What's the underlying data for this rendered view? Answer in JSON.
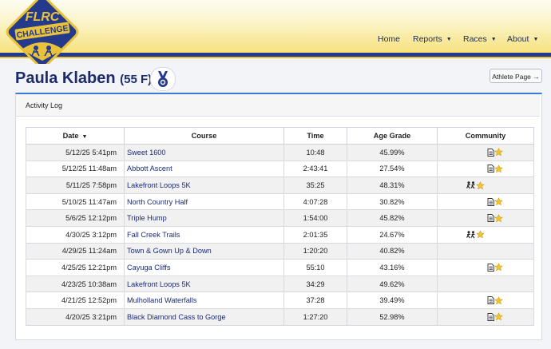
{
  "header": {
    "logo_text_top": "FLRC",
    "logo_text_main": "CHALLENGE",
    "nav": [
      {
        "label": "Home",
        "caret": false
      },
      {
        "label": "Reports",
        "caret": true
      },
      {
        "label": "Races",
        "caret": true
      },
      {
        "label": "About",
        "caret": true
      }
    ],
    "colors": {
      "navy": "#263a8c",
      "gold": "#e8c23a",
      "accent": "#3b7bd4"
    }
  },
  "athlete": {
    "name": "Paula Klaben",
    "age_gender": "(55 F)",
    "medal_icon": "medal-icon",
    "page_button": "Athlete Page",
    "page_button_icon": "arrow-right-icon"
  },
  "activity_log": {
    "title": "Activity Log",
    "columns": [
      "Date",
      "Course",
      "Time",
      "Age Grade",
      "Community"
    ],
    "sort_column": "Date",
    "rows": [
      {
        "date": "5/12/25 5:41pm",
        "course": "Sweet 1600",
        "time": "10:48",
        "age_grade": "45.99%",
        "community": "doc-star"
      },
      {
        "date": "5/12/25 11:48am",
        "course": "Abbott Ascent",
        "time": "2:43:41",
        "age_grade": "27.54%",
        "community": "doc-star"
      },
      {
        "date": "5/11/25 7:58pm",
        "course": "Lakefront Loops 5K",
        "time": "35:25",
        "age_grade": "48.31%",
        "community": "runners-star"
      },
      {
        "date": "5/10/25 11:47am",
        "course": "North Country Half",
        "time": "4:07:28",
        "age_grade": "30.82%",
        "community": "doc-star"
      },
      {
        "date": "5/6/25 12:12pm",
        "course": "Triple Hump",
        "time": "1:54:00",
        "age_grade": "45.82%",
        "community": "doc-star"
      },
      {
        "date": "4/30/25 3:12pm",
        "course": "Fall Creek Trails",
        "time": "2:01:35",
        "age_grade": "24.67%",
        "community": "runners-star"
      },
      {
        "date": "4/29/25 11:24am",
        "course": "Town & Gown Up & Down",
        "time": "1:20:20",
        "age_grade": "40.82%",
        "community": ""
      },
      {
        "date": "4/25/25 12:21pm",
        "course": "Cayuga Cliffs",
        "time": "55:10",
        "age_grade": "43.16%",
        "community": "doc-star"
      },
      {
        "date": "4/23/25 10:38am",
        "course": "Lakefront Loops 5K",
        "time": "34:29",
        "age_grade": "49.62%",
        "community": ""
      },
      {
        "date": "4/21/25 12:52pm",
        "course": "Mulholland Waterfalls",
        "time": "37:28",
        "age_grade": "39.49%",
        "community": "doc-star"
      },
      {
        "date": "4/20/25 3:21pm",
        "course": "Black Diamond Cass to Gorge",
        "time": "1:27:20",
        "age_grade": "52.98%",
        "community": "doc-star"
      }
    ]
  }
}
